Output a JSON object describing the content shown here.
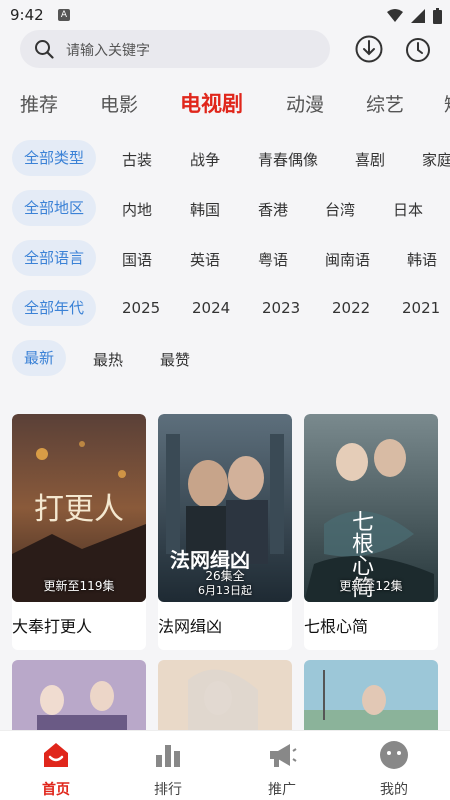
{
  "status_bar": {
    "time": "9:42",
    "notif_letter": "A"
  },
  "search": {
    "placeholder": "请输入关键字"
  },
  "tabs": [
    {
      "label": "推荐"
    },
    {
      "label": "电影"
    },
    {
      "label": "电视剧",
      "active": true
    },
    {
      "label": "动漫"
    },
    {
      "label": "综艺"
    },
    {
      "label": "短"
    }
  ],
  "filters": {
    "genre": {
      "active": "全部类型",
      "options": [
        "古装",
        "战争",
        "青春偶像",
        "喜剧",
        "家庭"
      ]
    },
    "region": {
      "active": "全部地区",
      "options": [
        "内地",
        "韩国",
        "香港",
        "台湾",
        "日本"
      ]
    },
    "language": {
      "active": "全部语言",
      "options": [
        "国语",
        "英语",
        "粤语",
        "闽南语",
        "韩语"
      ]
    },
    "year": {
      "active": "全部年代",
      "options": [
        "2025",
        "2024",
        "2023",
        "2022",
        "2021"
      ]
    },
    "sort": {
      "active": "最新",
      "options": [
        "最热",
        "最赞"
      ]
    }
  },
  "cards": [
    {
      "title": "大奉打更人",
      "badge": "更新至119集",
      "poster_text": "打更人"
    },
    {
      "title": "法网缉凶",
      "badge": "26集全",
      "sub_badge": "6月13日起",
      "poster_text": "法网缉凶"
    },
    {
      "title": "七根心简",
      "badge": "更新至12集",
      "poster_text": "七根心简"
    }
  ],
  "bottom_nav": [
    {
      "label": "首页",
      "icon": "home-icon",
      "active": true
    },
    {
      "label": "排行",
      "icon": "rank-icon"
    },
    {
      "label": "推广",
      "icon": "megaphone-icon"
    },
    {
      "label": "我的",
      "icon": "profile-icon"
    }
  ],
  "colors": {
    "accent": "#e0261b",
    "chip_text": "#3b82d6",
    "chip_bg": "#e4ebf6"
  }
}
